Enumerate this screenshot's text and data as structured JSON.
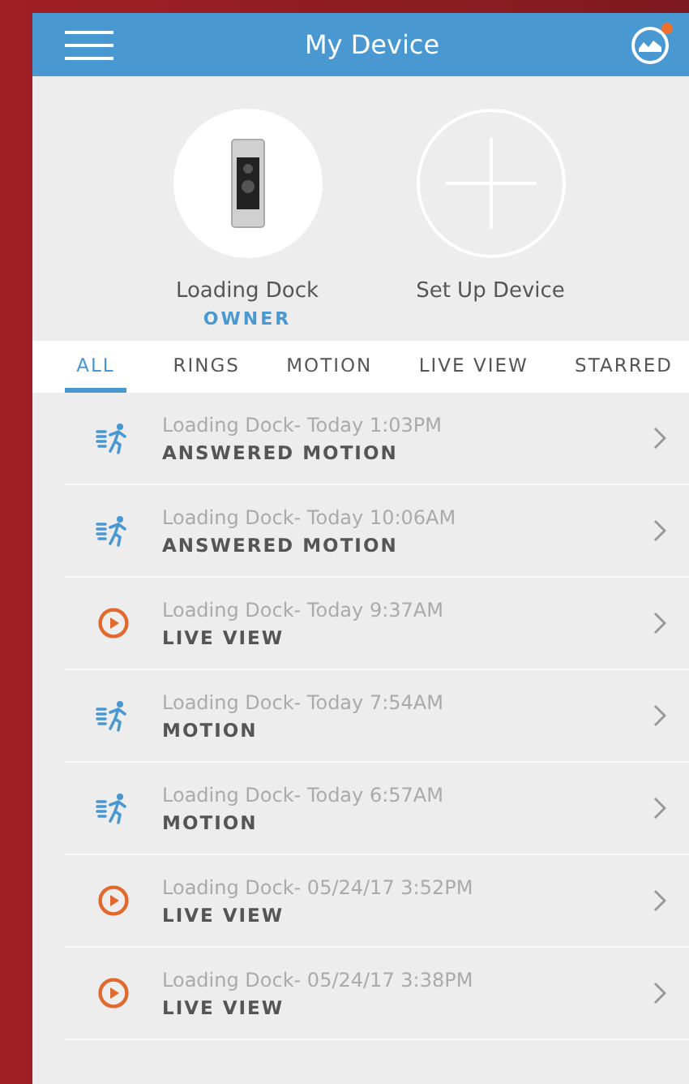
{
  "header": {
    "title": "My Device",
    "notification": true
  },
  "devices": [
    {
      "kind": "doorbell",
      "name": "Loading Dock",
      "role": "OWNER"
    },
    {
      "kind": "add",
      "name": "Set Up Device"
    }
  ],
  "tabs": [
    {
      "label": "ALL",
      "selected": true
    },
    {
      "label": "RINGS",
      "selected": false
    },
    {
      "label": "MOTION",
      "selected": false
    },
    {
      "label": "LIVE VIEW",
      "selected": false
    },
    {
      "label": "STARRED",
      "selected": false
    }
  ],
  "events": [
    {
      "kind": "motion",
      "subtitle": "Loading Dock- Today 1:03PM",
      "title": "ANSWERED MOTION"
    },
    {
      "kind": "motion",
      "subtitle": "Loading Dock- Today 10:06AM",
      "title": "ANSWERED MOTION"
    },
    {
      "kind": "live_view",
      "subtitle": "Loading Dock- Today 9:37AM",
      "title": "LIVE VIEW"
    },
    {
      "kind": "motion",
      "subtitle": "Loading Dock- Today 7:54AM",
      "title": "MOTION"
    },
    {
      "kind": "motion",
      "subtitle": "Loading Dock- Today 6:57AM",
      "title": "MOTION"
    },
    {
      "kind": "live_view",
      "subtitle": "Loading Dock- 05/24/17 3:52PM",
      "title": "LIVE VIEW"
    },
    {
      "kind": "live_view",
      "subtitle": "Loading Dock- 05/24/17 3:38PM",
      "title": "LIVE VIEW"
    }
  ]
}
